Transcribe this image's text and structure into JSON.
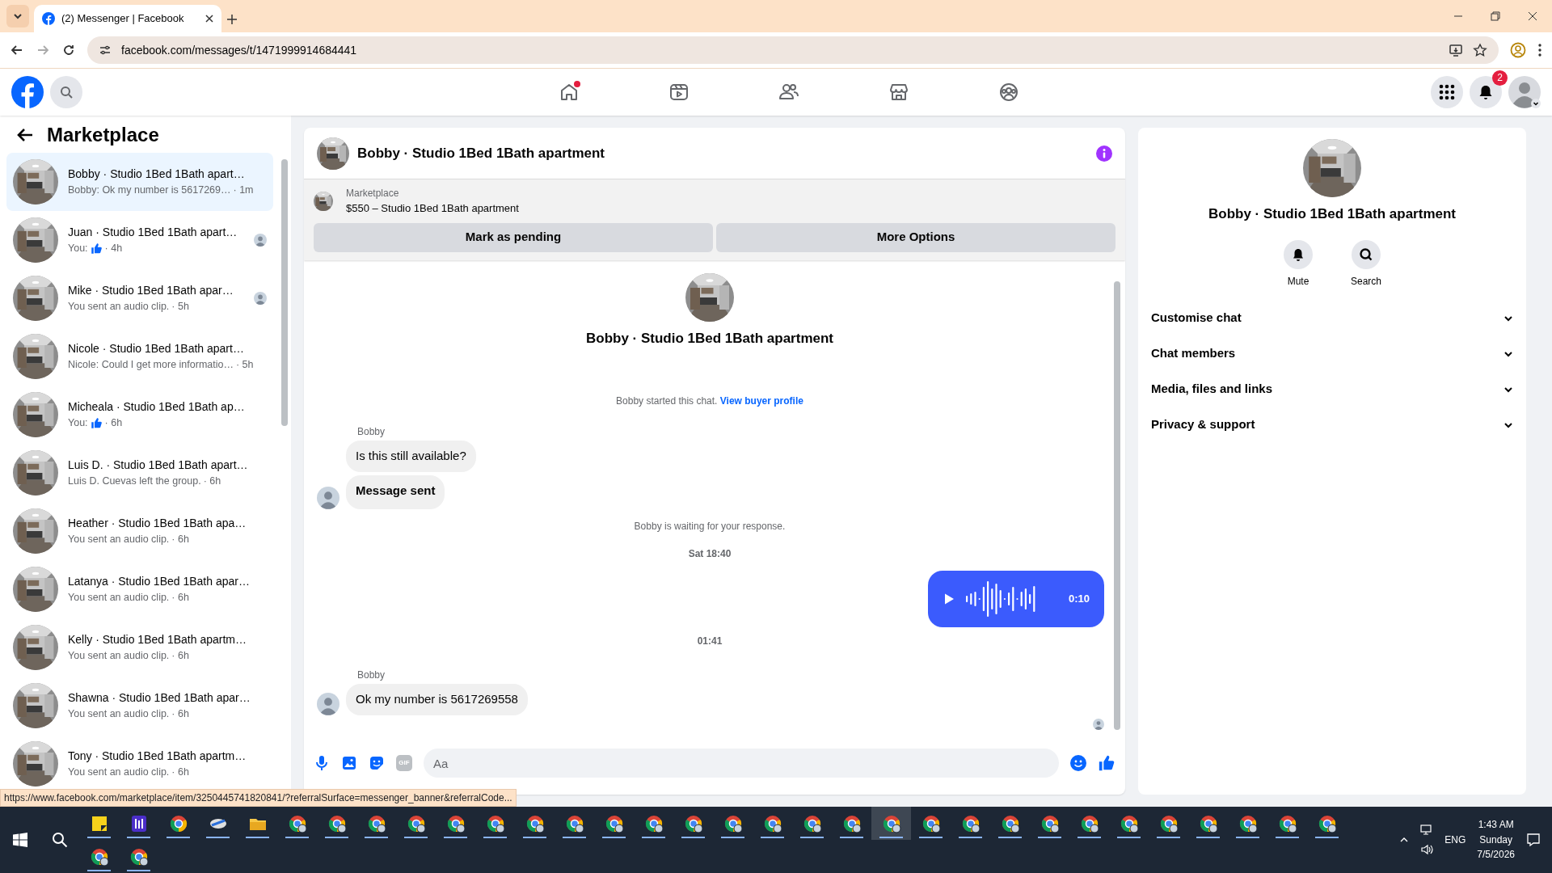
{
  "browser": {
    "tab_title": "(2) Messenger | Facebook",
    "url": "facebook.com/messages/t/1471999914684441",
    "status_url": "https://www.facebook.com/marketplace/item/3250445741820841/?referralSurface=messenger_banner&referralCode..."
  },
  "topnav": {
    "items": [
      {
        "kind": "home",
        "selected": false,
        "dot": true
      },
      {
        "kind": "video",
        "selected": false,
        "dot": false
      },
      {
        "kind": "friends",
        "selected": false,
        "dot": false
      },
      {
        "kind": "marketplace",
        "selected": false,
        "dot": false
      },
      {
        "kind": "groups",
        "selected": false,
        "dot": false
      }
    ],
    "notifications_badge": "2"
  },
  "sidebar": {
    "title": "Marketplace",
    "conversations": [
      {
        "name": "Bobby · Studio 1Bed 1Bath apart…",
        "preview": "Bobby: Ok my number is 5617269…",
        "like": false,
        "time": "· 1m",
        "seen": false,
        "selected": true
      },
      {
        "name": "Juan · Studio 1Bed 1Bath apart…",
        "preview": "You:",
        "like": true,
        "time": "· 4h",
        "seen": true,
        "selected": false
      },
      {
        "name": "Mike · Studio 1Bed 1Bath apar…",
        "preview": "You sent an audio clip.",
        "like": false,
        "time": "· 5h",
        "seen": true,
        "selected": false
      },
      {
        "name": "Nicole · Studio 1Bed 1Bath apart…",
        "preview": "Nicole: Could I get more informatio…",
        "like": false,
        "time": "· 5h",
        "seen": false,
        "selected": false
      },
      {
        "name": "Micheala · Studio 1Bed 1Bath ap…",
        "preview": "You:",
        "like": true,
        "time": "· 6h",
        "seen": false,
        "selected": false
      },
      {
        "name": "Luis D. · Studio 1Bed 1Bath apart…",
        "preview": "Luis D. Cuevas left the group.",
        "like": false,
        "time": "· 6h",
        "seen": false,
        "selected": false
      },
      {
        "name": "Heather · Studio 1Bed 1Bath apa…",
        "preview": "You sent an audio clip.",
        "like": false,
        "time": "· 6h",
        "seen": false,
        "selected": false
      },
      {
        "name": "Latanya · Studio 1Bed 1Bath apar…",
        "preview": "You sent an audio clip.",
        "like": false,
        "time": "· 6h",
        "seen": false,
        "selected": false
      },
      {
        "name": "Kelly · Studio 1Bed 1Bath apartm…",
        "preview": "You sent an audio clip.",
        "like": false,
        "time": "· 6h",
        "seen": false,
        "selected": false
      },
      {
        "name": "Shawna · Studio 1Bed 1Bath apar…",
        "preview": "You sent an audio clip.",
        "like": false,
        "time": "· 6h",
        "seen": false,
        "selected": false
      },
      {
        "name": "Tony · Studio 1Bed 1Bath apartm…",
        "preview": "You sent an audio clip.",
        "like": false,
        "time": "· 6h",
        "seen": false,
        "selected": false
      }
    ]
  },
  "chat": {
    "title": "Bobby · Studio 1Bed 1Bath apartment",
    "banner": {
      "label": "Marketplace",
      "listing": "$550 – Studio 1Bed 1Bath apartment",
      "buttons": [
        "Mark as pending",
        "More Options"
      ]
    },
    "messages": [
      {
        "kind": "intro",
        "title": "Bobby · Studio 1Bed 1Bath apartment"
      },
      {
        "kind": "system",
        "text": "Bobby started this chat.",
        "link": "View buyer profile"
      },
      {
        "kind": "group",
        "sender": "Bobby",
        "bubbles": [
          {
            "text": "Is this still available?",
            "emphasis": false
          },
          {
            "text": "Message sent",
            "emphasis": true
          }
        ]
      },
      {
        "kind": "system",
        "text": "Bobby is waiting for your response."
      },
      {
        "kind": "timestamp",
        "text": "Sat 18:40"
      },
      {
        "kind": "audio",
        "duration": "0:10"
      },
      {
        "kind": "timestamp",
        "text": "01:41"
      },
      {
        "kind": "group",
        "sender": "Bobby",
        "bubbles": [
          {
            "text": "Ok my number is 5617269558",
            "emphasis": false
          }
        ]
      }
    ],
    "seen": true,
    "composer": {
      "placeholder": "Aa",
      "gif_label": "GIF"
    }
  },
  "details": {
    "title": "Bobby · Studio 1Bed 1Bath apartment",
    "actions": [
      {
        "kind": "mute",
        "label": "Mute"
      },
      {
        "kind": "search",
        "label": "Search"
      }
    ],
    "sections": [
      {
        "label": "Customise chat",
        "expanded": false
      },
      {
        "label": "Chat members",
        "expanded": false
      },
      {
        "label": "Media, files and links",
        "expanded": false
      },
      {
        "label": "Privacy & support",
        "expanded": false
      }
    ]
  },
  "taskbar": {
    "apps": [
      {
        "kind": "notes",
        "selected": false
      },
      {
        "kind": "app",
        "selected": false
      },
      {
        "kind": "chrome",
        "selected": false
      },
      {
        "kind": "satellite",
        "selected": false
      },
      {
        "kind": "folder",
        "selected": false
      },
      {
        "kind": "profile",
        "selected": false
      },
      {
        "kind": "profile",
        "selected": false
      },
      {
        "kind": "profile",
        "selected": false
      },
      {
        "kind": "profile",
        "selected": false
      },
      {
        "kind": "profile",
        "selected": false
      },
      {
        "kind": "profile",
        "selected": false
      },
      {
        "kind": "profile",
        "selected": false
      },
      {
        "kind": "profile",
        "selected": false
      },
      {
        "kind": "profile",
        "selected": false
      },
      {
        "kind": "profile",
        "selected": false
      },
      {
        "kind": "profile",
        "selected": false
      },
      {
        "kind": "profile",
        "selected": false
      },
      {
        "kind": "profile",
        "selected": false
      },
      {
        "kind": "profile",
        "selected": false
      },
      {
        "kind": "profile",
        "selected": false
      },
      {
        "kind": "profile",
        "selected": true
      },
      {
        "kind": "profile",
        "selected": false
      },
      {
        "kind": "profile",
        "selected": false
      },
      {
        "kind": "profile",
        "selected": false
      },
      {
        "kind": "profile",
        "selected": false
      },
      {
        "kind": "profile",
        "selected": false
      },
      {
        "kind": "profile",
        "selected": false
      },
      {
        "kind": "profile",
        "selected": false
      },
      {
        "kind": "profile",
        "selected": false
      },
      {
        "kind": "profile",
        "selected": false
      },
      {
        "kind": "profile",
        "selected": false
      },
      {
        "kind": "profile",
        "selected": false
      },
      {
        "kind": "profile",
        "selected": false
      },
      {
        "kind": "profile",
        "selected": false
      }
    ],
    "language": "ENG",
    "time": "1:43 AM",
    "day": "Sunday",
    "date": "7/5/2026"
  }
}
